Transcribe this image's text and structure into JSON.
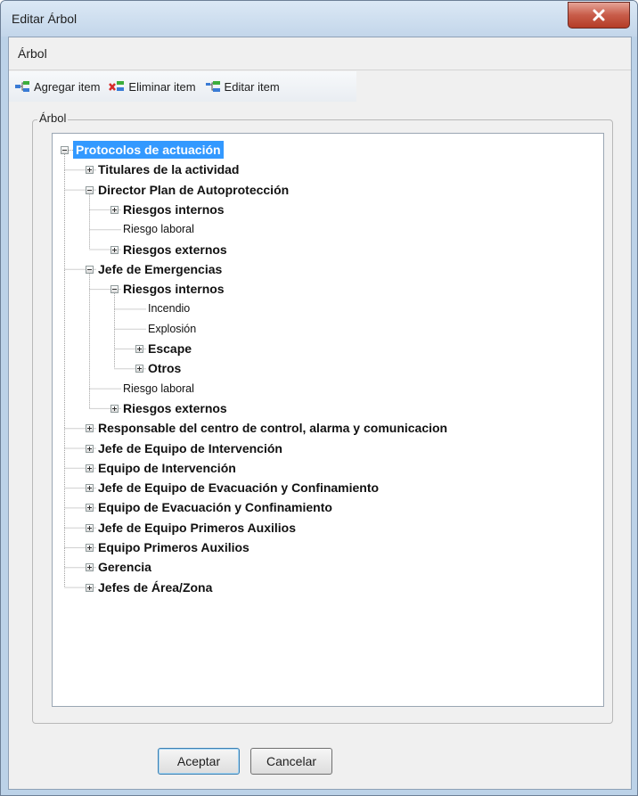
{
  "window": {
    "title": "Editar Árbol",
    "close_icon": "close-icon"
  },
  "section_label": "Árbol",
  "toolbar": {
    "items": [
      {
        "label": "Agregar item",
        "icon": "add-node-icon"
      },
      {
        "label": "Eliminar item",
        "icon": "delete-node-icon"
      },
      {
        "label": "Editar item",
        "icon": "edit-node-icon"
      }
    ]
  },
  "group_label": "Árbol",
  "tree": {
    "nodes": [
      {
        "label": "Protocolos de actuación",
        "level": 0,
        "expander": "expanded",
        "bold": true,
        "selected": true
      },
      {
        "label": "Titulares de la actividad",
        "level": 1,
        "expander": "collapsed",
        "bold": true
      },
      {
        "label": "Director Plan de Autoprotección",
        "level": 1,
        "expander": "expanded",
        "bold": true
      },
      {
        "label": "Riesgos internos",
        "level": 2,
        "expander": "collapsed",
        "bold": true
      },
      {
        "label": "Riesgo laboral",
        "level": 2,
        "expander": "none",
        "bold": false
      },
      {
        "label": "Riesgos externos",
        "level": 2,
        "expander": "collapsed",
        "bold": true
      },
      {
        "label": "Jefe de Emergencias",
        "level": 1,
        "expander": "expanded",
        "bold": true
      },
      {
        "label": "Riesgos internos",
        "level": 2,
        "expander": "expanded",
        "bold": true
      },
      {
        "label": "Incendio",
        "level": 3,
        "expander": "none",
        "bold": false
      },
      {
        "label": "Explosión",
        "level": 3,
        "expander": "none",
        "bold": false
      },
      {
        "label": "Escape",
        "level": 3,
        "expander": "collapsed",
        "bold": true
      },
      {
        "label": "Otros",
        "level": 3,
        "expander": "collapsed",
        "bold": true
      },
      {
        "label": "Riesgo laboral",
        "level": 2,
        "expander": "none",
        "bold": false
      },
      {
        "label": "Riesgos externos",
        "level": 2,
        "expander": "collapsed",
        "bold": true
      },
      {
        "label": "Responsable del centro de control, alarma y comunicacion",
        "level": 1,
        "expander": "collapsed",
        "bold": true
      },
      {
        "label": "Jefe de Equipo de Intervención",
        "level": 1,
        "expander": "collapsed",
        "bold": true
      },
      {
        "label": "Equipo de Intervención",
        "level": 1,
        "expander": "collapsed",
        "bold": true
      },
      {
        "label": "Jefe de Equipo de Evacuación y Confinamiento",
        "level": 1,
        "expander": "collapsed",
        "bold": true
      },
      {
        "label": "Equipo de Evacuación y Confinamiento",
        "level": 1,
        "expander": "collapsed",
        "bold": true
      },
      {
        "label": "Jefe de Equipo Primeros Auxilios",
        "level": 1,
        "expander": "collapsed",
        "bold": true
      },
      {
        "label": "Equipo Primeros Auxilios",
        "level": 1,
        "expander": "collapsed",
        "bold": true
      },
      {
        "label": "Gerencia",
        "level": 1,
        "expander": "collapsed",
        "bold": true
      },
      {
        "label": "Jefes de Área/Zona",
        "level": 1,
        "expander": "collapsed",
        "bold": true
      }
    ]
  },
  "buttons": {
    "accept": "Aceptar",
    "cancel": "Cancelar"
  },
  "colors": {
    "selection": "#3399ff",
    "close_button": "#c85c49"
  }
}
